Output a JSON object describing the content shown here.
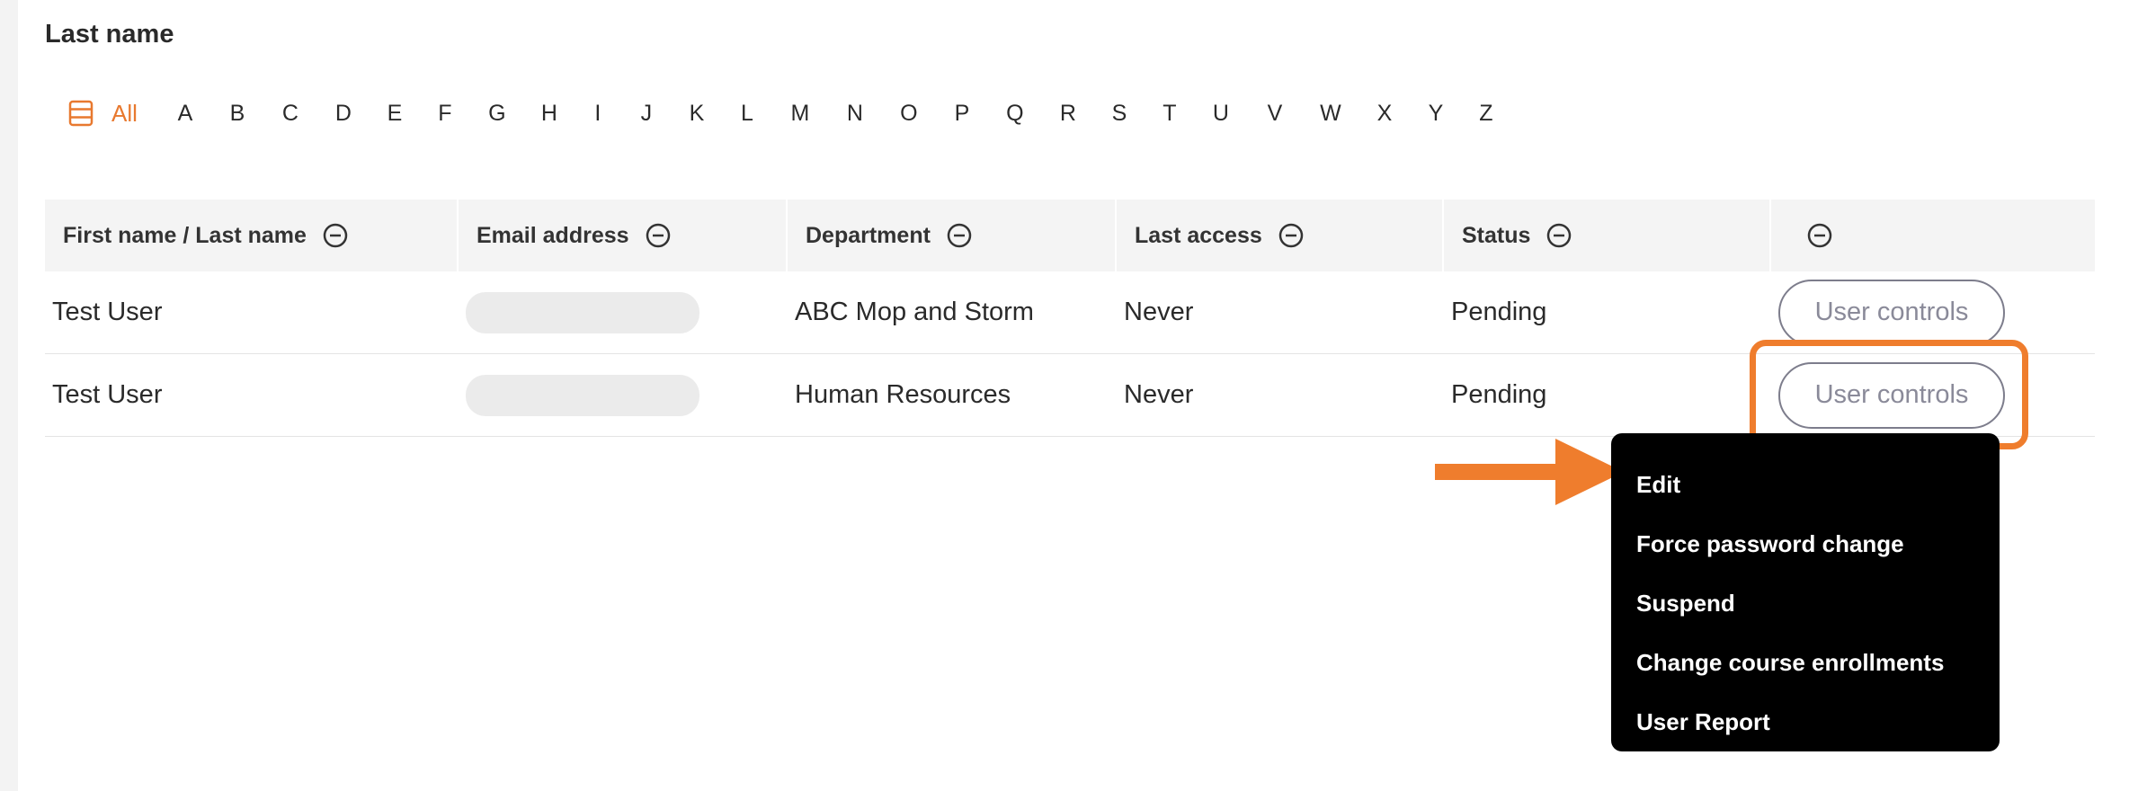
{
  "section_title": "Last name",
  "alphabet": {
    "all_label": "All",
    "letters": [
      "A",
      "B",
      "C",
      "D",
      "E",
      "F",
      "G",
      "H",
      "I",
      "J",
      "K",
      "L",
      "M",
      "N",
      "O",
      "P",
      "Q",
      "R",
      "S",
      "T",
      "U",
      "V",
      "W",
      "X",
      "Y",
      "Z"
    ]
  },
  "table": {
    "columns": [
      "First name / Last name",
      "Email address",
      "Department",
      "Last access",
      "Status",
      ""
    ],
    "rows": [
      {
        "name": "Test User",
        "department": "ABC Mop and Storm",
        "last_access": "Never",
        "status": "Pending",
        "action": "User controls"
      },
      {
        "name": "Test User",
        "department": "Human Resources",
        "last_access": "Never",
        "status": "Pending",
        "action": "User controls"
      }
    ]
  },
  "menu": {
    "items": [
      "Edit",
      "Force password change",
      "Suspend",
      "Change course enrollments",
      "User Report"
    ]
  },
  "colors": {
    "accent": "#e8792f",
    "highlight": "#ef7d2d",
    "menu_bg": "#000000"
  }
}
